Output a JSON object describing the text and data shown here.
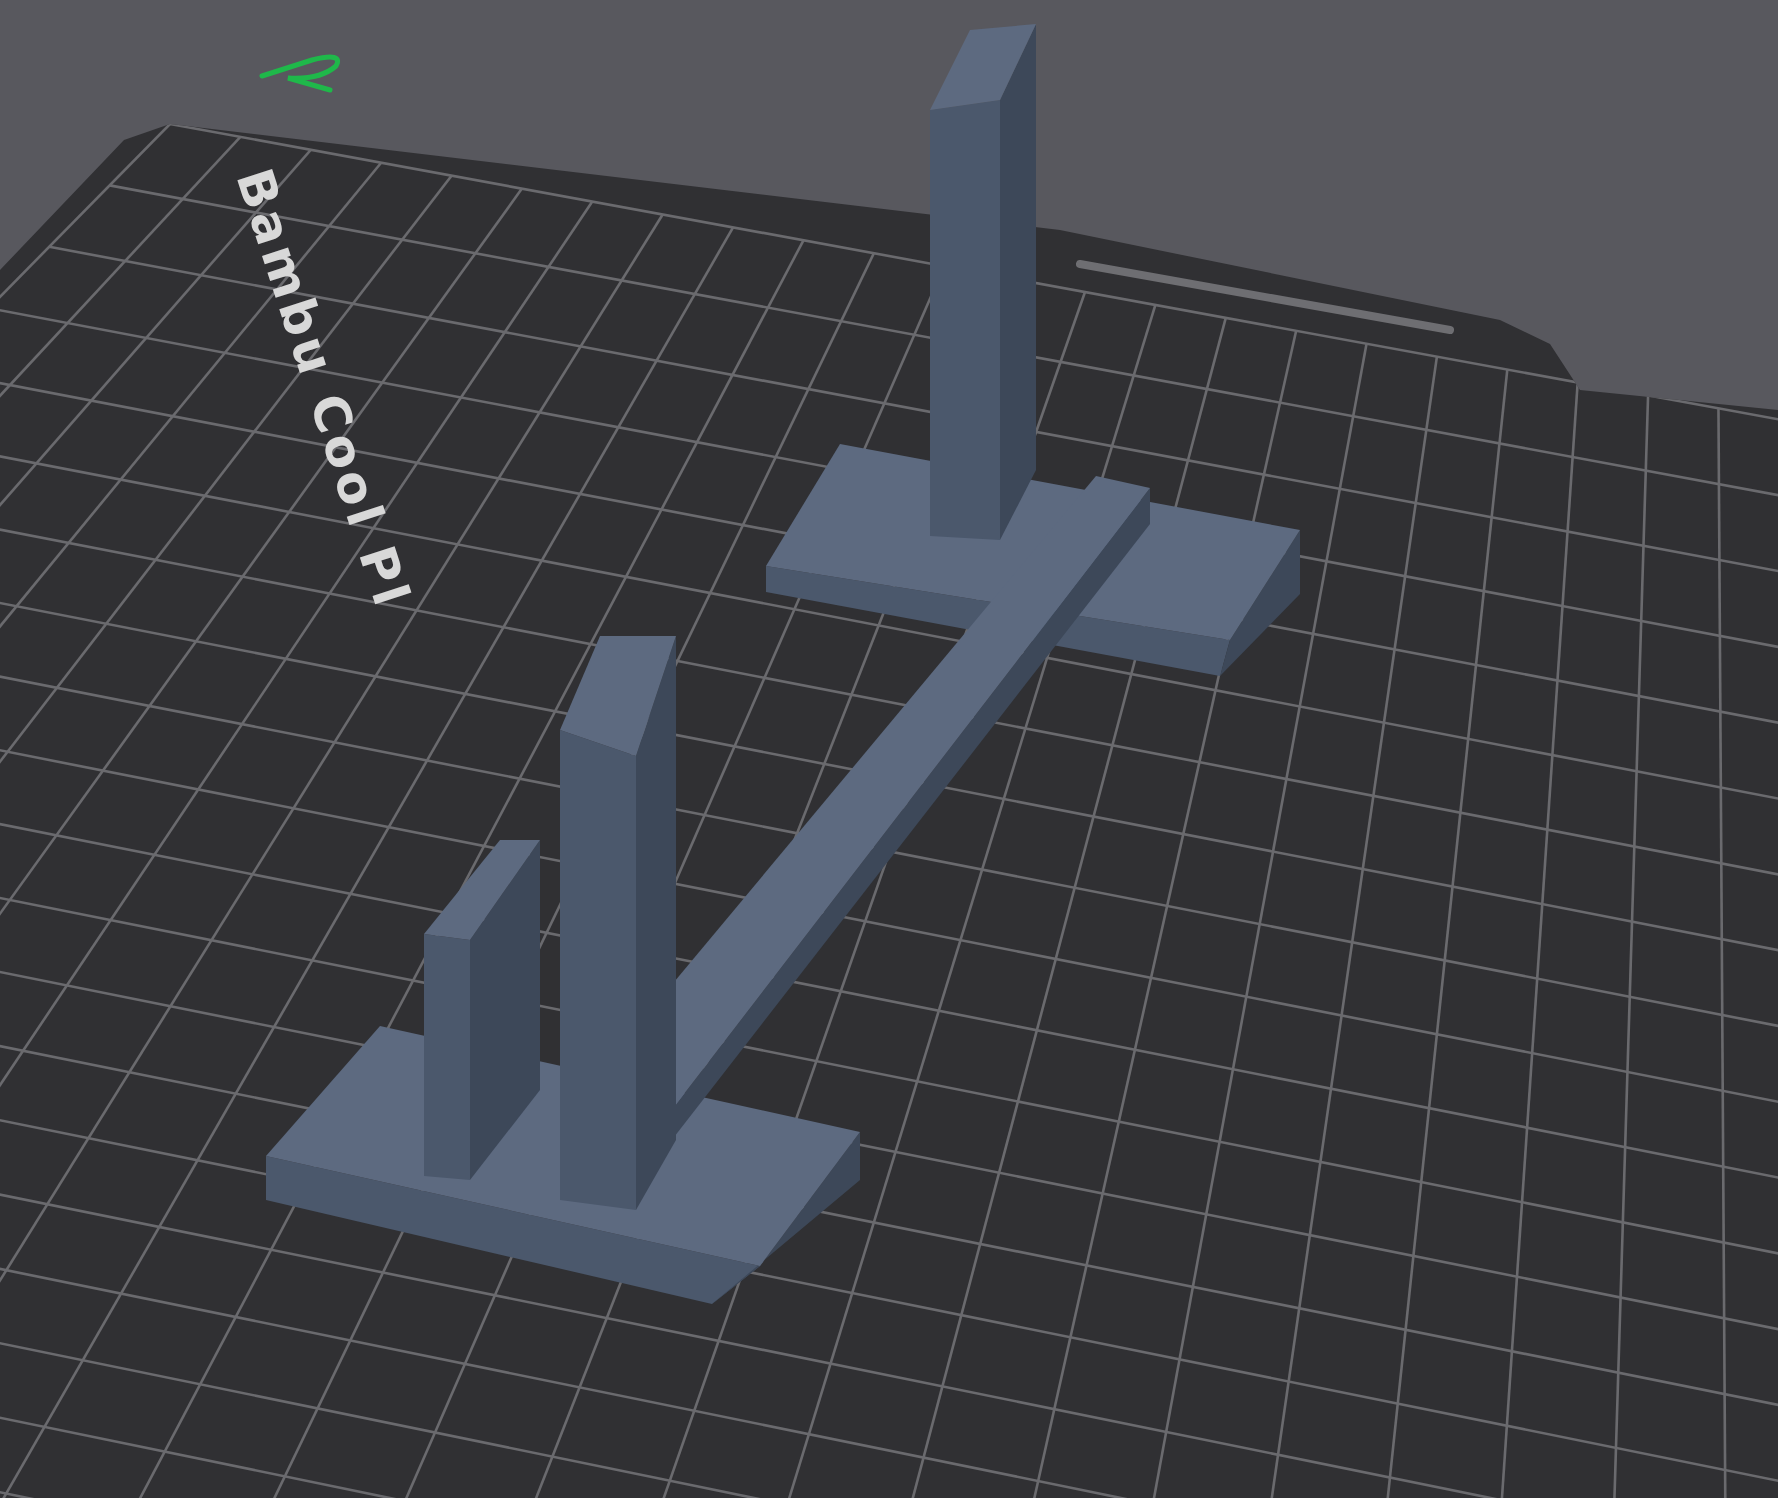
{
  "viewport": {
    "plate": {
      "label": "Bambu Cool Pl"
    }
  }
}
